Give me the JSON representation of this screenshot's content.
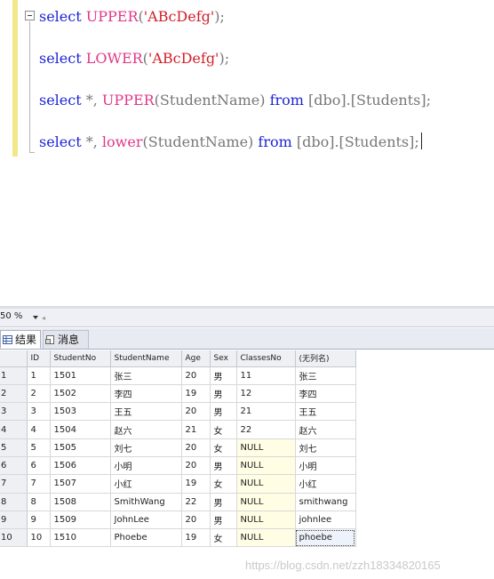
{
  "editor": {
    "lines": [
      {
        "kw": "select",
        "fn": "UPPER",
        "open": "(",
        "str": "'ABcDefg'",
        "close": ");"
      },
      {
        "kw": "select",
        "fn": "LOWER",
        "open": "(",
        "str": "'ABcDefg'",
        "close": ");"
      },
      {
        "kw": "select",
        "star": " *, ",
        "fn": "UPPER",
        "arg": "(StudentName)",
        "kw2": "from",
        "tbl": "[dbo].[Students];"
      },
      {
        "kw": "select",
        "star": " *, ",
        "fn": "lower",
        "arg": "(StudentName)",
        "kw2": "from",
        "tbl": "[dbo].[Students];"
      }
    ]
  },
  "zoom": {
    "value": "50 %"
  },
  "tabs": [
    {
      "label": "结果",
      "active": true
    },
    {
      "label": "消息",
      "active": false
    }
  ],
  "grid": {
    "columns": [
      "ID",
      "StudentNo",
      "StudentName",
      "Age",
      "Sex",
      "ClassesNo",
      "(无列名)"
    ],
    "rows": [
      {
        "rownum": "1",
        "cells": [
          "1",
          "1501",
          "张三",
          "20",
          "男",
          "11",
          "张三"
        ]
      },
      {
        "rownum": "2",
        "cells": [
          "2",
          "1502",
          "李四",
          "19",
          "男",
          "12",
          "李四"
        ]
      },
      {
        "rownum": "3",
        "cells": [
          "3",
          "1503",
          "王五",
          "20",
          "男",
          "21",
          "王五"
        ]
      },
      {
        "rownum": "4",
        "cells": [
          "4",
          "1504",
          "赵六",
          "21",
          "女",
          "22",
          "赵六"
        ]
      },
      {
        "rownum": "5",
        "cells": [
          "5",
          "1505",
          "刘七",
          "20",
          "女",
          "NULL",
          "刘七"
        ]
      },
      {
        "rownum": "6",
        "cells": [
          "6",
          "1506",
          "小明",
          "20",
          "男",
          "NULL",
          "小明"
        ]
      },
      {
        "rownum": "7",
        "cells": [
          "7",
          "1507",
          "小红",
          "19",
          "女",
          "NULL",
          "小红"
        ]
      },
      {
        "rownum": "8",
        "cells": [
          "8",
          "1508",
          "SmithWang",
          "22",
          "男",
          "NULL",
          "smithwang"
        ]
      },
      {
        "rownum": "9",
        "cells": [
          "9",
          "1509",
          "JohnLee",
          "20",
          "男",
          "NULL",
          "johnlee"
        ]
      },
      {
        "rownum": "10",
        "cells": [
          "10",
          "1510",
          "Phoebe",
          "19",
          "女",
          "NULL",
          "phoebe"
        ]
      }
    ]
  },
  "watermark": "https://blog.csdn.net/zzh18334820165",
  "colors": {
    "keyword": "#1c24d6",
    "function": "#e0388a",
    "string": "#d0202a",
    "null_cell_bg": "#fffde3"
  }
}
